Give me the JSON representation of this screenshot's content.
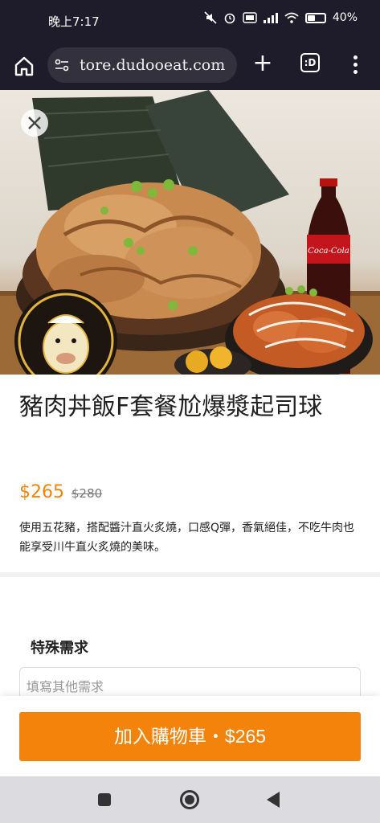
{
  "status_bar": {
    "time": "晚上7:17",
    "battery": "40%",
    "icons": [
      "mute-icon",
      "alarm-icon",
      "volte-icon",
      "signal-icon",
      "wifi-icon",
      "battery-icon"
    ]
  },
  "browser": {
    "url": "tore.dudooeat.com",
    "tab_label": ":D",
    "icons": [
      "home-icon",
      "site-info-icon",
      "plus-icon",
      "menu-icon"
    ]
  },
  "product": {
    "title": "豬肉丼飯F套餐尬爆漿起司球",
    "price": "$265",
    "original_price": "$280",
    "description": "使用五花豬，搭配醬汁直火炙燒，口感Q彈，香氣絕佳，不吃牛肉也能享受川牛直火炙燒的美味。"
  },
  "special_request": {
    "title": "特殊需求",
    "placeholder": "填寫其他需求"
  },
  "cart": {
    "button_label": "加入購物車・$265"
  },
  "image_text": {
    "drink_label": "Coca-Cola"
  },
  "colors": {
    "accent": "#f4830b",
    "browser_bg": "#1e1b2a"
  }
}
